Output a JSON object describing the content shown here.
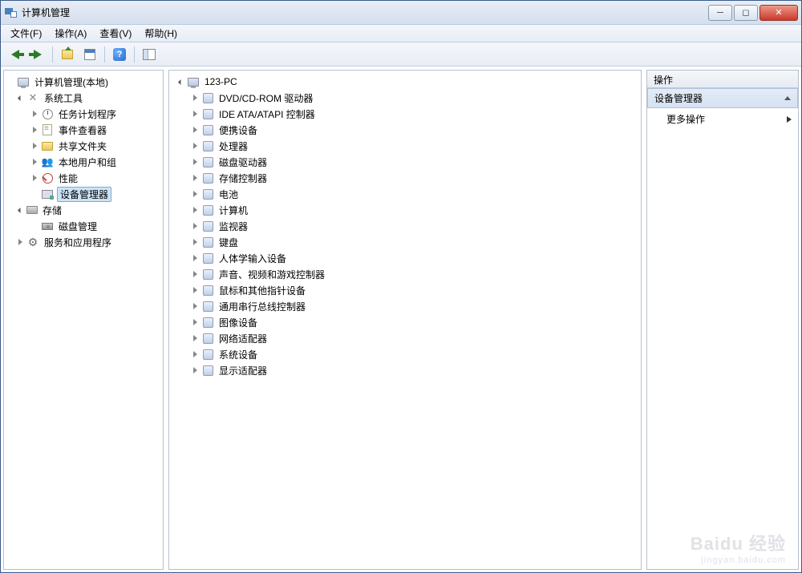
{
  "window": {
    "title": "计算机管理"
  },
  "menubar": [
    "文件(F)",
    "操作(A)",
    "查看(V)",
    "帮助(H)"
  ],
  "left_tree": {
    "root": "计算机管理(本地)",
    "groups": [
      {
        "label": "系统工具",
        "icon": "ic-tools",
        "expanded": true,
        "children": [
          {
            "label": "任务计划程序",
            "icon": "ic-clock",
            "expandable": true
          },
          {
            "label": "事件查看器",
            "icon": "ic-event",
            "expandable": true
          },
          {
            "label": "共享文件夹",
            "icon": "ic-folder",
            "expandable": true
          },
          {
            "label": "本地用户和组",
            "icon": "ic-users",
            "expandable": true
          },
          {
            "label": "性能",
            "icon": "ic-perf",
            "expandable": true
          },
          {
            "label": "设备管理器",
            "icon": "ic-devmgr",
            "expandable": false,
            "selected": true
          }
        ]
      },
      {
        "label": "存储",
        "icon": "ic-storage",
        "expanded": true,
        "children": [
          {
            "label": "磁盘管理",
            "icon": "ic-disk",
            "expandable": false
          }
        ]
      },
      {
        "label": "服务和应用程序",
        "icon": "ic-gear",
        "expanded": false,
        "children": []
      }
    ]
  },
  "center_tree": {
    "root": "123-PC",
    "devices": [
      "DVD/CD-ROM 驱动器",
      "IDE ATA/ATAPI 控制器",
      "便携设备",
      "处理器",
      "磁盘驱动器",
      "存储控制器",
      "电池",
      "计算机",
      "监视器",
      "键盘",
      "人体学输入设备",
      "声音、视频和游戏控制器",
      "鼠标和其他指针设备",
      "通用串行总线控制器",
      "图像设备",
      "网络适配器",
      "系统设备",
      "显示适配器"
    ]
  },
  "actions": {
    "header": "操作",
    "section": "设备管理器",
    "more": "更多操作"
  },
  "watermark": {
    "main": "Baidu 经验",
    "sub": "jingyan.baidu.com"
  }
}
